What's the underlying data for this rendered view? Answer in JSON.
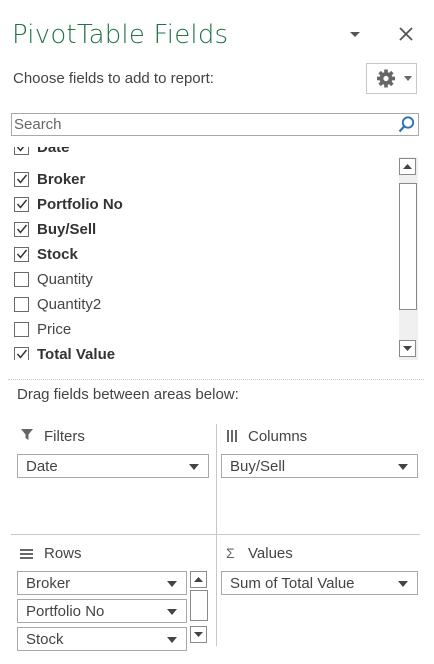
{
  "pane": {
    "title": "PivotTable Fields",
    "choose_label": "Choose fields to add to report:"
  },
  "search": {
    "placeholder": "Search"
  },
  "fields": [
    {
      "label": "Date",
      "checked": true,
      "bold": true
    },
    {
      "label": "Broker",
      "checked": true,
      "bold": true
    },
    {
      "label": "Portfolio No",
      "checked": true,
      "bold": true
    },
    {
      "label": "Buy/Sell",
      "checked": true,
      "bold": true
    },
    {
      "label": "Stock",
      "checked": true,
      "bold": true
    },
    {
      "label": "Quantity",
      "checked": false,
      "bold": false
    },
    {
      "label": "Quantity2",
      "checked": false,
      "bold": false
    },
    {
      "label": "Price",
      "checked": false,
      "bold": false
    },
    {
      "label": "Total Value",
      "checked": true,
      "bold": true
    }
  ],
  "areas": {
    "drag_label": "Drag fields between areas below:",
    "filters": {
      "title": "Filters",
      "items": [
        "Date"
      ]
    },
    "columns": {
      "title": "Columns",
      "items": [
        "Buy/Sell"
      ]
    },
    "rows": {
      "title": "Rows",
      "items": [
        "Broker",
        "Portfolio No",
        "Stock"
      ]
    },
    "values": {
      "title": "Values",
      "items": [
        "Sum of Total Value"
      ]
    }
  },
  "icons": {
    "title_dropdown": "chevron-down-icon",
    "close": "close-icon",
    "settings": "gear-icon",
    "search": "search-icon",
    "filters": "filter-icon",
    "columns": "columns-icon",
    "rows": "rows-icon",
    "values": "sigma-icon"
  },
  "colors": {
    "title": "#217346",
    "border": "#a8a8a8",
    "search_icon": "#2b6fb6"
  }
}
